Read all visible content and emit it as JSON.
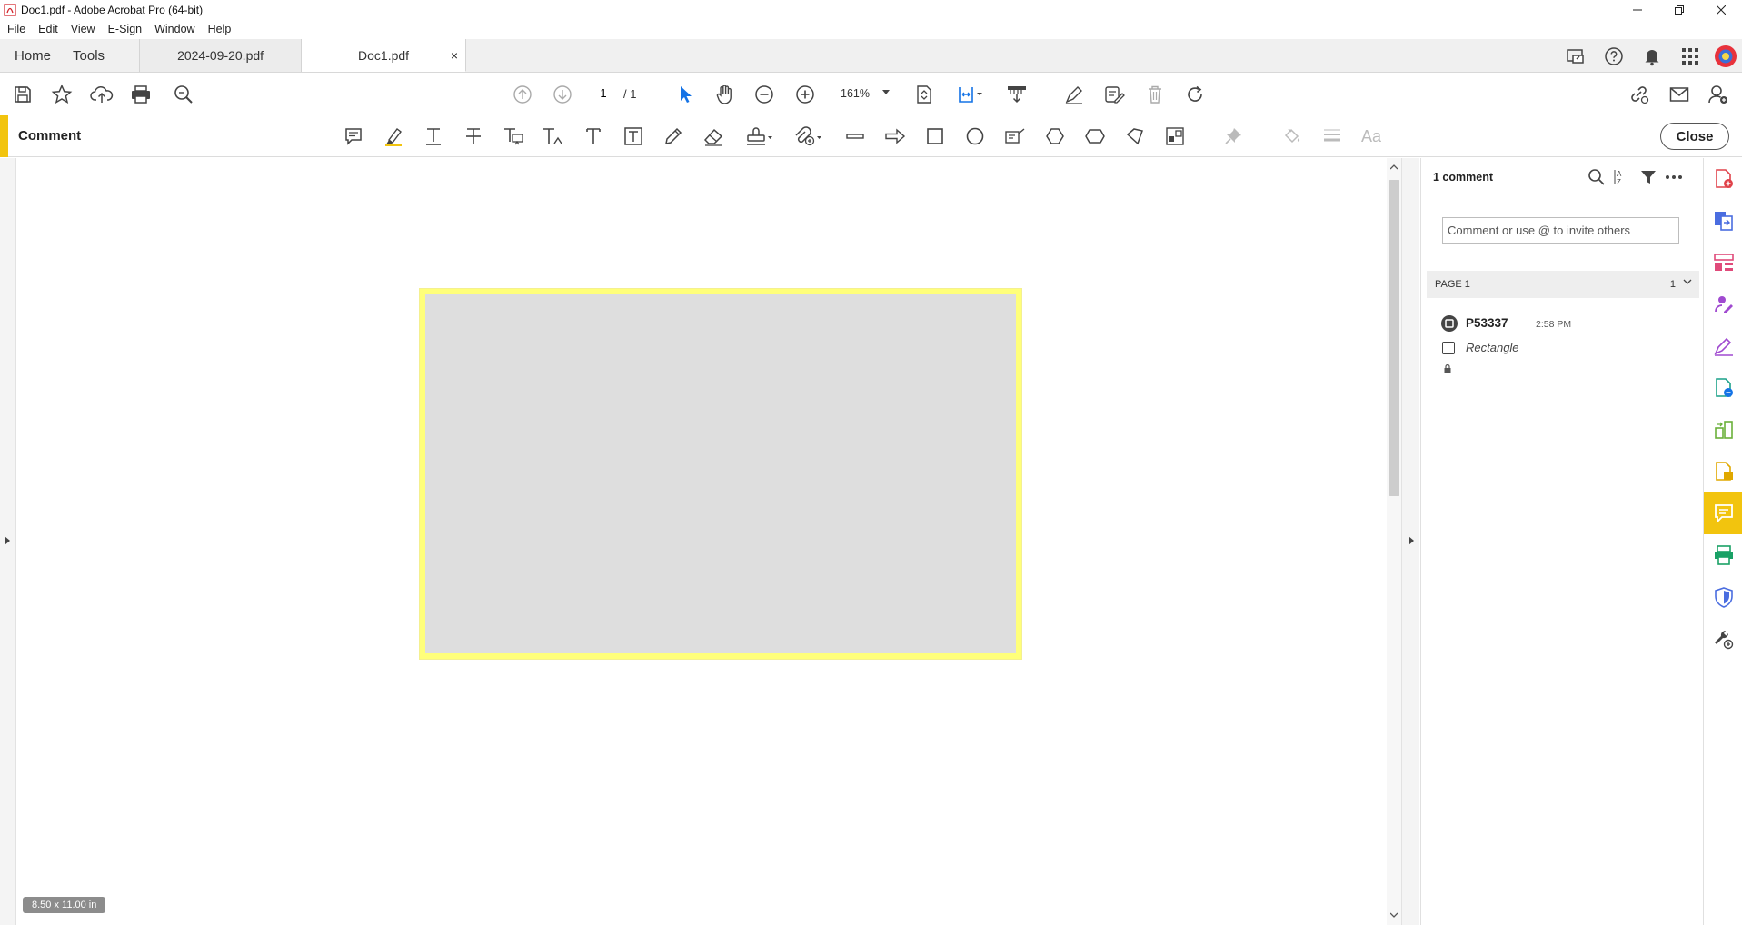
{
  "window": {
    "title": "Doc1.pdf - Adobe Acrobat Pro (64-bit)"
  },
  "menu": [
    "File",
    "Edit",
    "View",
    "E-Sign",
    "Window",
    "Help"
  ],
  "tabs": {
    "home": "Home",
    "tools": "Tools",
    "documents": [
      {
        "label": "2024-09-20.pdf"
      },
      {
        "label": "Doc1.pdf",
        "close": "×"
      }
    ]
  },
  "toolbar": {
    "current_page": "1",
    "total_pages": "/ 1",
    "zoom": "161%"
  },
  "comment_toolbar": {
    "label": "Comment",
    "close_label": "Close",
    "accent_color": "#f2c40e"
  },
  "document": {
    "page_size": "8.50 x 11.00 in",
    "annotation_border_color": "#ffff7a",
    "annotation_fill_color": "#dedede"
  },
  "comments_panel": {
    "count_label": "1 comment",
    "input_placeholder": "Comment or use @ to invite others",
    "page_header": "PAGE 1",
    "page_count": "1",
    "comments": [
      {
        "author": "P53337",
        "time": "2:58 PM",
        "type": "Rectangle"
      }
    ]
  },
  "icons": {
    "rail": [
      "create-pdf-icon",
      "export-pdf-icon",
      "organize-pages-icon",
      "fill-sign-icon",
      "request-esign-icon",
      "edit-pdf-icon",
      "combine-files-icon",
      "export-icon",
      "comment-icon",
      "scan-ocr-icon",
      "protect-icon",
      "more-tools-icon"
    ]
  }
}
